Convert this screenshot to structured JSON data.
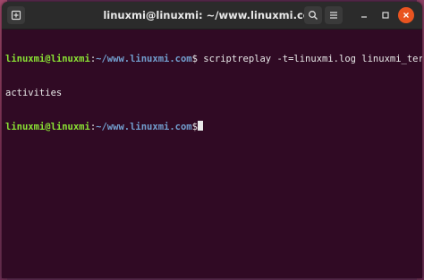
{
  "window": {
    "title": "linuxmi@linuxmi: ~/www.linuxmi.com"
  },
  "terminal": {
    "lines": [
      {
        "user": "linuxmi@linuxmi",
        "sep": ":",
        "path": "~/www.linuxmi.com",
        "prompt": "$",
        "command": " scriptreplay -t=linuxmi.log linuxmi_terminal_"
      },
      {
        "text": "activities"
      },
      {
        "user": "linuxmi@linuxmi",
        "sep": ":",
        "path": "~/www.linuxmi.com",
        "prompt": "$",
        "command": ""
      }
    ]
  },
  "colors": {
    "terminal_bg": "#300a24",
    "user": "#8ae234",
    "path": "#729fcf",
    "close_button": "#e95420"
  },
  "icons": {
    "new_tab": "new-tab-icon",
    "search": "search-icon",
    "menu": "hamburger-menu-icon",
    "minimize": "minimize-icon",
    "maximize": "maximize-icon",
    "close": "close-icon"
  }
}
